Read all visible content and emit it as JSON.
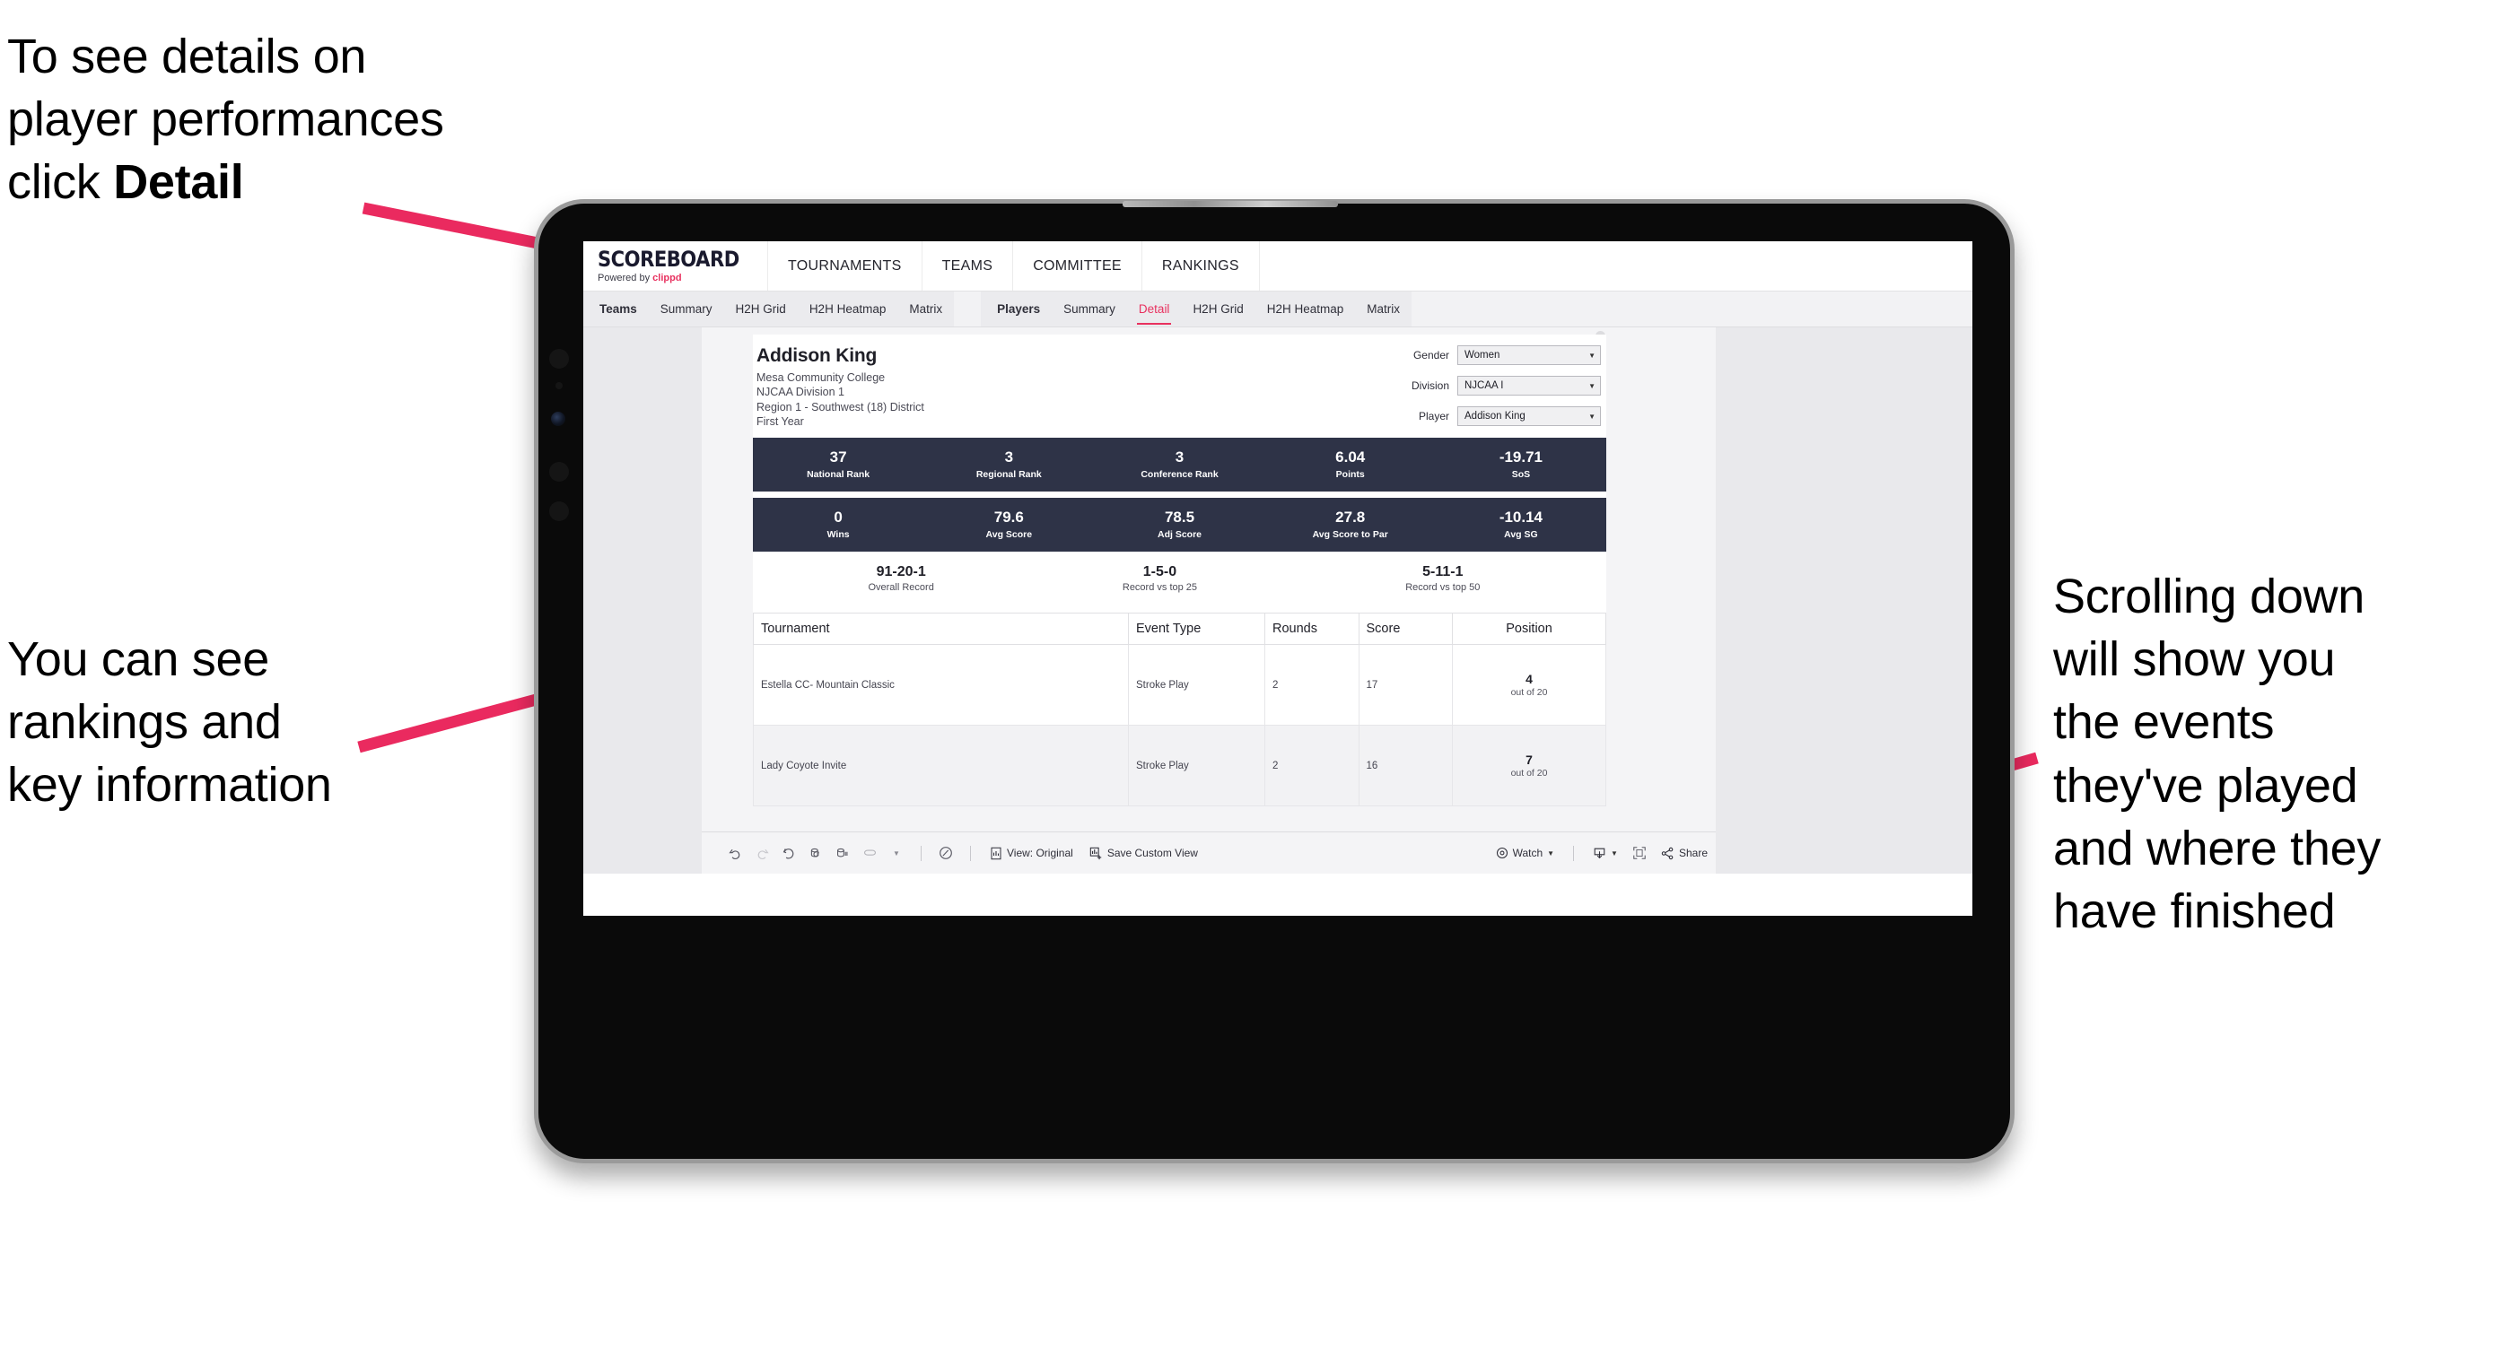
{
  "annotations": {
    "top_left": "To see details on\nplayer performances\nclick ",
    "top_left_bold": "Detail",
    "mid_left": "You can see\nrankings and\nkey information",
    "right": "Scrolling down\nwill show you\nthe events\nthey've played\nand where they\nhave finished",
    "accent_color": "#ea2a5f"
  },
  "app": {
    "brand_title": "SCOREBOARD",
    "brand_sub_prefix": "Powered by ",
    "brand_sub_name": "clippd",
    "top_nav": [
      {
        "label": "TOURNAMENTS"
      },
      {
        "label": "TEAMS"
      },
      {
        "label": "COMMITTEE"
      },
      {
        "label": "RANKINGS"
      }
    ],
    "sub_nav": {
      "teams_group": [
        {
          "label": "Teams",
          "head": true
        },
        {
          "label": "Summary"
        },
        {
          "label": "H2H Grid"
        },
        {
          "label": "H2H Heatmap"
        },
        {
          "label": "Matrix"
        }
      ],
      "players_group": [
        {
          "label": "Players",
          "head": true
        },
        {
          "label": "Summary"
        },
        {
          "label": "Detail",
          "active": true
        },
        {
          "label": "H2H Grid"
        },
        {
          "label": "H2H Heatmap"
        },
        {
          "label": "Matrix"
        }
      ]
    }
  },
  "player": {
    "name": "Addison King",
    "school": "Mesa Community College",
    "division": "NJCAA Division 1",
    "region": "Region 1 - Southwest (18) District",
    "year": "First Year"
  },
  "filters": [
    {
      "label": "Gender",
      "value": "Women"
    },
    {
      "label": "Division",
      "value": "NJCAA I"
    },
    {
      "label": "Player",
      "value": "Addison King"
    }
  ],
  "kpi_row_1": [
    {
      "value": "37",
      "label": "National Rank"
    },
    {
      "value": "3",
      "label": "Regional Rank"
    },
    {
      "value": "3",
      "label": "Conference Rank"
    },
    {
      "value": "6.04",
      "label": "Points"
    },
    {
      "value": "-19.71",
      "label": "SoS"
    }
  ],
  "kpi_row_2": [
    {
      "value": "0",
      "label": "Wins"
    },
    {
      "value": "79.6",
      "label": "Avg Score"
    },
    {
      "value": "78.5",
      "label": "Adj Score"
    },
    {
      "value": "27.8",
      "label": "Avg Score to Par"
    },
    {
      "value": "-10.14",
      "label": "Avg SG"
    }
  ],
  "records": [
    {
      "value": "91-20-1",
      "label": "Overall Record"
    },
    {
      "value": "1-5-0",
      "label": "Record vs top 25"
    },
    {
      "value": "5-11-1",
      "label": "Record vs top 50"
    }
  ],
  "results_table": {
    "columns": [
      "Tournament",
      "Event Type",
      "Rounds",
      "Score",
      "Position"
    ],
    "rows": [
      {
        "tournament": "Estella CC- Mountain Classic",
        "event_type": "Stroke Play",
        "rounds": "2",
        "score": "17",
        "position_num": "4",
        "position_of": "out of 20"
      },
      {
        "tournament": "Lady Coyote Invite",
        "event_type": "Stroke Play",
        "rounds": "2",
        "score": "16",
        "position_num": "7",
        "position_of": "out of 20"
      }
    ]
  },
  "toolbar": {
    "view_label": "View: Original",
    "save_label": "Save Custom View",
    "watch_label": "Watch",
    "share_label": "Share"
  }
}
